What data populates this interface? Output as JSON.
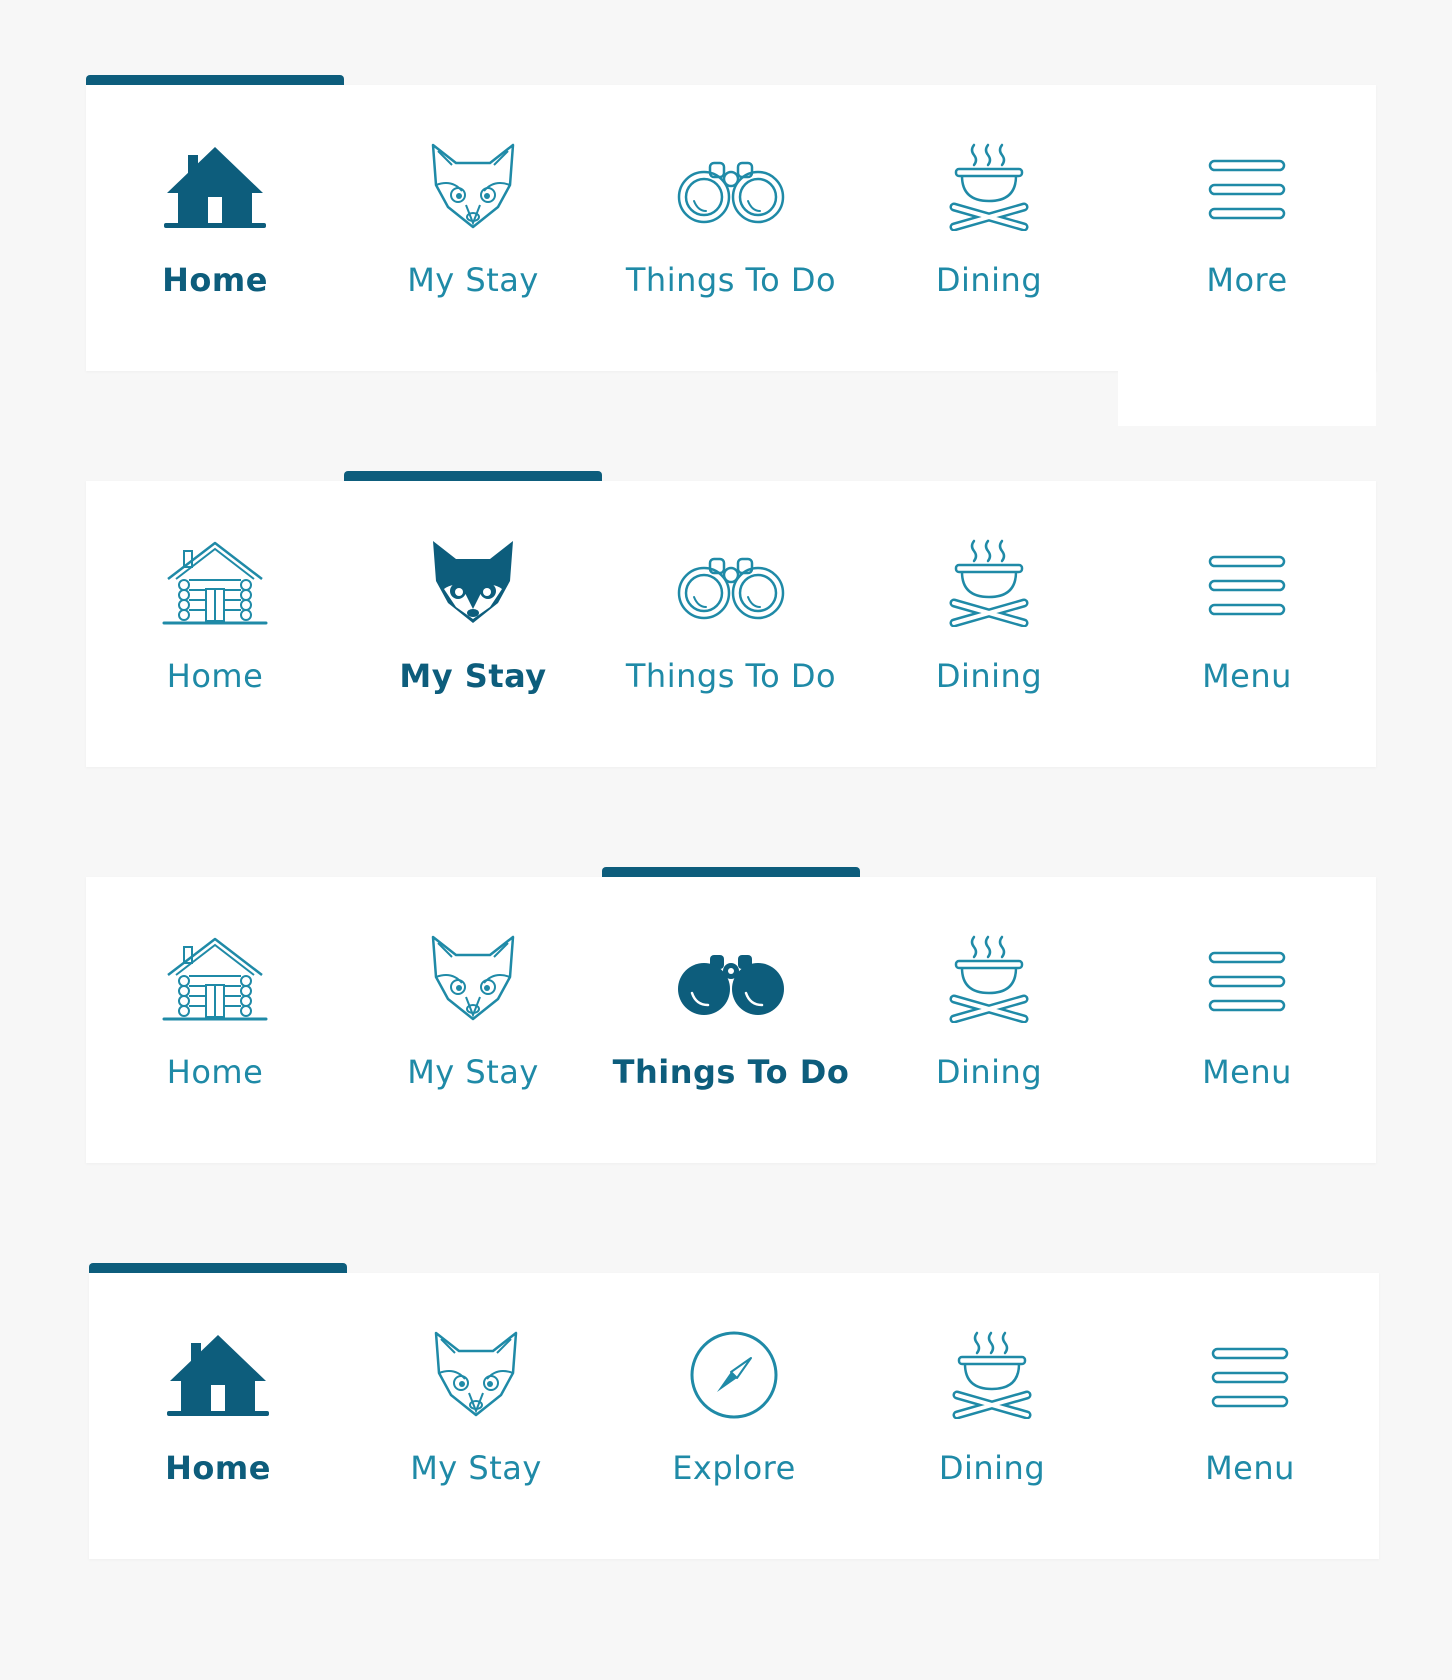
{
  "colors": {
    "page_background": "#f7f7f7",
    "bar_background": "#ffffff",
    "active": "#0d5d7c",
    "inactive": "#1f8aa7"
  },
  "navbars": [
    {
      "id": "bar-1",
      "active_index": 0,
      "items": [
        {
          "label": "Home",
          "icon": "house-icon",
          "active": true
        },
        {
          "label": "My Stay",
          "icon": "fox-icon",
          "active": false
        },
        {
          "label": "Things To Do",
          "icon": "binoculars-icon",
          "active": false
        },
        {
          "label": "Dining",
          "icon": "cooking-pot-icon",
          "active": false
        },
        {
          "label": "More",
          "icon": "hamburger-icon",
          "active": false
        }
      ]
    },
    {
      "id": "bar-2",
      "active_index": 1,
      "items": [
        {
          "label": "Home",
          "icon": "log-cabin-icon",
          "active": false
        },
        {
          "label": "My Stay",
          "icon": "fox-icon",
          "active": true
        },
        {
          "label": "Things To Do",
          "icon": "binoculars-icon",
          "active": false
        },
        {
          "label": "Dining",
          "icon": "cooking-pot-icon",
          "active": false
        },
        {
          "label": "Menu",
          "icon": "hamburger-icon",
          "active": false
        }
      ]
    },
    {
      "id": "bar-3",
      "active_index": 2,
      "items": [
        {
          "label": "Home",
          "icon": "log-cabin-icon",
          "active": false
        },
        {
          "label": "My Stay",
          "icon": "fox-icon",
          "active": false
        },
        {
          "label": "Things To Do",
          "icon": "binoculars-icon",
          "active": true
        },
        {
          "label": "Dining",
          "icon": "cooking-pot-icon",
          "active": false
        },
        {
          "label": "Menu",
          "icon": "hamburger-icon",
          "active": false
        }
      ]
    },
    {
      "id": "bar-4",
      "active_index": 0,
      "items": [
        {
          "label": "Home",
          "icon": "house-icon",
          "active": true
        },
        {
          "label": "My Stay",
          "icon": "fox-icon",
          "active": false
        },
        {
          "label": "Explore",
          "icon": "compass-icon",
          "active": false
        },
        {
          "label": "Dining",
          "icon": "cooking-pot-icon",
          "active": false
        },
        {
          "label": "Menu",
          "icon": "hamburger-icon",
          "active": false
        }
      ]
    }
  ]
}
